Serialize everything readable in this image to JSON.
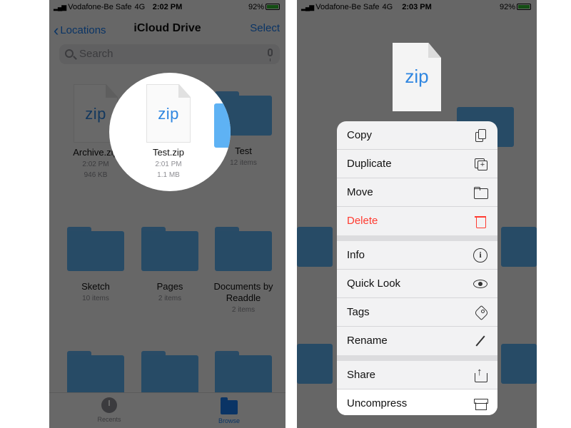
{
  "left": {
    "status": {
      "carrier": "Vodafone-Be Safe",
      "network": "4G",
      "time": "2:02 PM",
      "battery": "92%"
    },
    "nav": {
      "back_label": "Locations",
      "title": "iCloud Drive",
      "select_label": "Select"
    },
    "search": {
      "placeholder": "Search"
    },
    "files": [
      {
        "name": "Archive.zip",
        "time": "2:02 PM",
        "size": "946 KB"
      },
      {
        "name": "Test.zip",
        "time": "2:01 PM",
        "size": "1.1 MB"
      },
      {
        "name": "Test",
        "count": "12 items"
      },
      {
        "name": "Sketch",
        "count": "10 items"
      },
      {
        "name": "Pages",
        "count": "2 items"
      },
      {
        "name": "Documents by Readdle",
        "count": "2 items"
      }
    ],
    "zip_glyph": "zip",
    "tabs": [
      {
        "label": "Recents"
      },
      {
        "label": "Browse"
      }
    ]
  },
  "right": {
    "status": {
      "carrier": "Vodafone-Be Safe",
      "network": "4G",
      "time": "2:03 PM",
      "battery": "92%"
    },
    "preview_glyph": "zip",
    "menu": [
      {
        "label": "Copy",
        "icon": "copy-icon"
      },
      {
        "label": "Duplicate",
        "icon": "duplicate-icon"
      },
      {
        "label": "Move",
        "icon": "folder-icon"
      },
      {
        "label": "Delete",
        "icon": "trash-icon"
      },
      {
        "label": "Info",
        "icon": "info-icon"
      },
      {
        "label": "Quick Look",
        "icon": "eye-icon"
      },
      {
        "label": "Tags",
        "icon": "tag-icon"
      },
      {
        "label": "Rename",
        "icon": "pencil-icon"
      },
      {
        "label": "Share",
        "icon": "share-icon"
      },
      {
        "label": "Uncompress",
        "icon": "archive-icon"
      }
    ]
  },
  "colors": {
    "accent": "#1a7cf0",
    "folder": "#5eb2f4",
    "destructive": "#ff3b30",
    "zip_text": "#2f86e0"
  }
}
